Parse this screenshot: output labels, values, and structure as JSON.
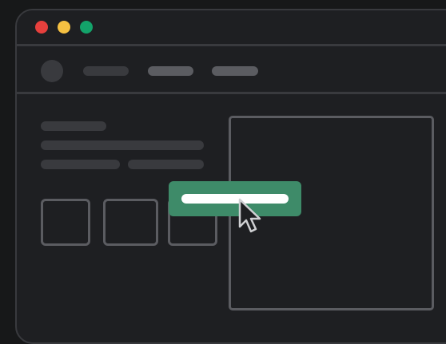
{
  "colors": {
    "background": "#171819",
    "window": "#1e1f22",
    "border": "#393a3e",
    "placeholder_dim": "#393a3e",
    "placeholder_bright": "#5b5c61",
    "accent": "#3e8b69",
    "traffic_close": "#e7403d",
    "traffic_minimize": "#f6c142",
    "traffic_maximize": "#13a36a"
  },
  "icons": {
    "cursor": "arrow-pointer-icon"
  }
}
